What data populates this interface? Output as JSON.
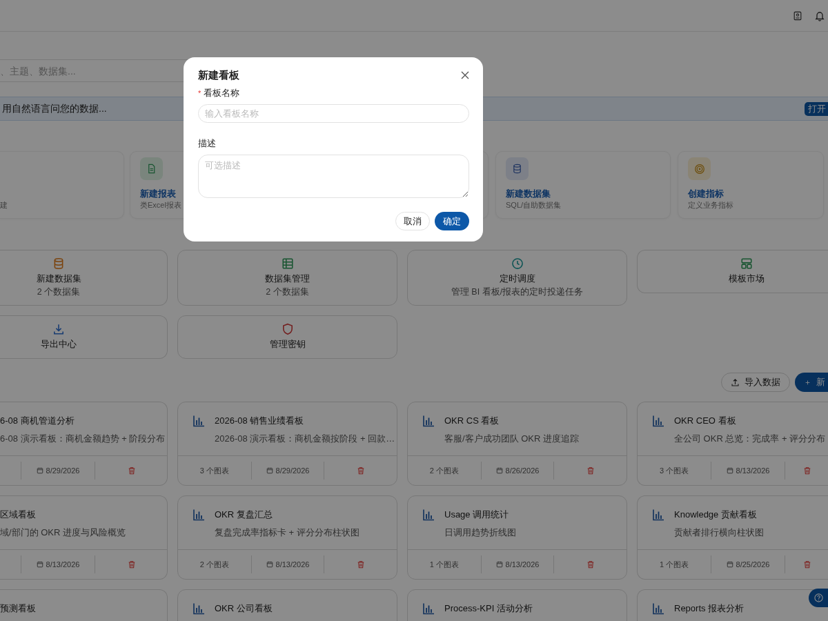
{
  "search": {
    "placeholder": "、主题、数据集..."
  },
  "ai_bar": {
    "placeholder": "用自然语言问您的数据...",
    "button": "打开"
  },
  "quick_create": [
    {
      "subtitle": "建"
    },
    {
      "title": "新建报表",
      "subtitle": "类Excel报表"
    },
    {
      "title": "新建数据集",
      "subtitle": "SQL/自助数据集"
    },
    {
      "title": "创建指标",
      "subtitle": "定义业务指标"
    }
  ],
  "tools": [
    {
      "title": "新建数据集",
      "subtitle": "2 个数据集"
    },
    {
      "title": "数据集管理",
      "subtitle": "2 个数据集"
    },
    {
      "title": "定时调度",
      "subtitle": "管理 BI 看板/报表的定时投递任务"
    },
    {
      "title": "模板市场"
    },
    {
      "title": "导出中心"
    },
    {
      "title": "管理密钥"
    }
  ],
  "toolbar": {
    "import": "导入数据",
    "create": "新"
  },
  "boards": [
    {
      "title": "6-08 商机管道分析",
      "description": "6-08 演示看板：商机金额趋势 + 阶段分布",
      "date": "8/29/2026"
    },
    {
      "title": "2026-08 销售业绩看板",
      "description": "2026-08 演示看板：商机金额按阶段 + 回款…",
      "charts": "3 个图表",
      "date": "8/29/2026"
    },
    {
      "title": "OKR CS 看板",
      "description": "客服/客户成功团队 OKR 进度追踪",
      "charts": "2 个图表",
      "date": "8/26/2026"
    },
    {
      "title": "OKR CEO 看板",
      "description": "全公司 OKR 总览：完成率 + 评分分布",
      "charts": "3 个图表",
      "date": "8/13/2026"
    },
    {
      "title": "区域看板",
      "description": "域/部门的 OKR 进度与风险概览",
      "date": "8/13/2026"
    },
    {
      "title": "OKR 复盘汇总",
      "description": "复盘完成率指标卡 + 评分分布柱状图",
      "charts": "2 个图表",
      "date": "8/13/2026"
    },
    {
      "title": "Usage 调用统计",
      "description": "日调用趋势折线图",
      "charts": "1 个图表",
      "date": "8/13/2026"
    },
    {
      "title": "Knowledge 贡献看板",
      "description": "贡献者排行横向柱状图",
      "charts": "1 个图表",
      "date": "8/25/2026"
    },
    {
      "title": "预测看板"
    },
    {
      "title": "OKR 公司看板"
    },
    {
      "title": "Process-KPI 活动分析"
    },
    {
      "title": "Reports 报表分析"
    }
  ],
  "dialog": {
    "title": "新建看板",
    "name_label": "看板名称",
    "required_mark": "*",
    "name_placeholder": "输入看板名称",
    "desc_label": "描述",
    "desc_placeholder": "可选描述",
    "cancel": "取消",
    "confirm": "确定"
  }
}
